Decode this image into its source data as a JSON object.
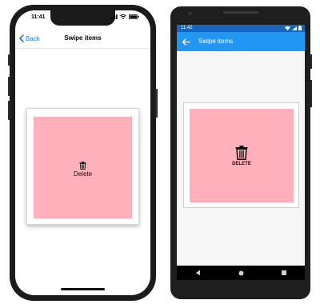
{
  "ios": {
    "status_time": "11:41",
    "nav_back_label": "Back",
    "nav_title": "Swipe items",
    "item_label": "Delete",
    "item_icon": "trash-icon",
    "item_color": "#ffb0bb",
    "accent_color": "#1a7bf2"
  },
  "android": {
    "status_time": "11:42",
    "toolbar_title": "Swipe items",
    "item_label": "DELETE",
    "item_icon": "trash-icon",
    "item_color": "#ffb0bb",
    "toolbar_color": "#2196f3",
    "statusbar_color": "#1566c0"
  }
}
